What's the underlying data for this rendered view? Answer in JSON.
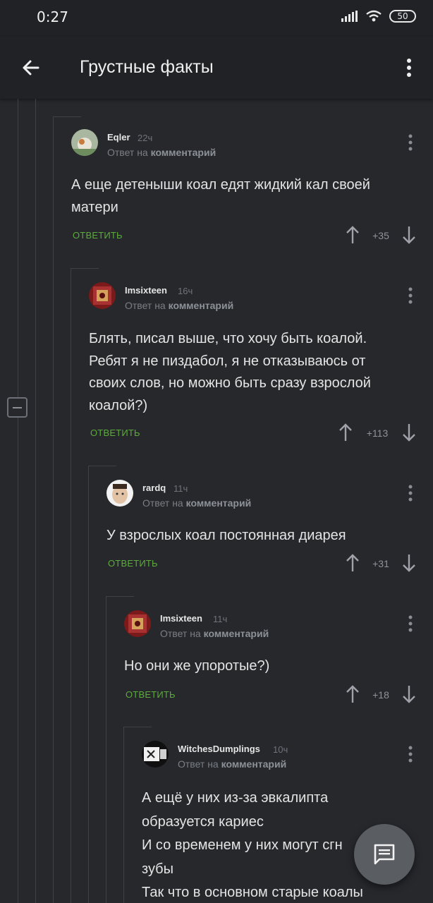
{
  "status": {
    "time": "0:27",
    "battery": "50"
  },
  "appbar": {
    "title": "Грустные факты"
  },
  "common": {
    "reply_prefix": "Ответ на",
    "reply_target": "комментарий",
    "reply_label": "ОТВЕТИТЬ"
  },
  "comments": [
    {
      "author": "Eqler",
      "time": "22ч",
      "text": "А еще детеныши коал едят жидкий кал своей\nматери",
      "score": "+35"
    },
    {
      "author": "Imsixteen",
      "time": "16ч",
      "text": "Блять, писал выше, что хочу быть коалой.\nРебят я не пиздабол, я не отказываюсь от\nсвоих слов, но можно быть сразу взрослой\nкоалой?)",
      "score": "+113"
    },
    {
      "author": "rardq",
      "time": "11ч",
      "text": "У взрослых коал постоянная диарея",
      "score": "+31"
    },
    {
      "author": "Imsixteen",
      "time": "11ч",
      "text": "Но они же упоротые?)",
      "score": "+18"
    },
    {
      "author": "WitchesDumplings",
      "time": "10ч",
      "text": "А ещё у них из-за эвкалипта\nобразуется кариес\nИ со временем у них могут сгн\nзубы\nТак что в основном старые коалы"
    }
  ],
  "colors": {
    "background": "#26282c",
    "appbar": "#202225",
    "reply_green": "#5cab3c"
  },
  "icons": {
    "back": "arrow-left-icon",
    "menu": "more-vert-icon",
    "fab": "comment-icon"
  }
}
